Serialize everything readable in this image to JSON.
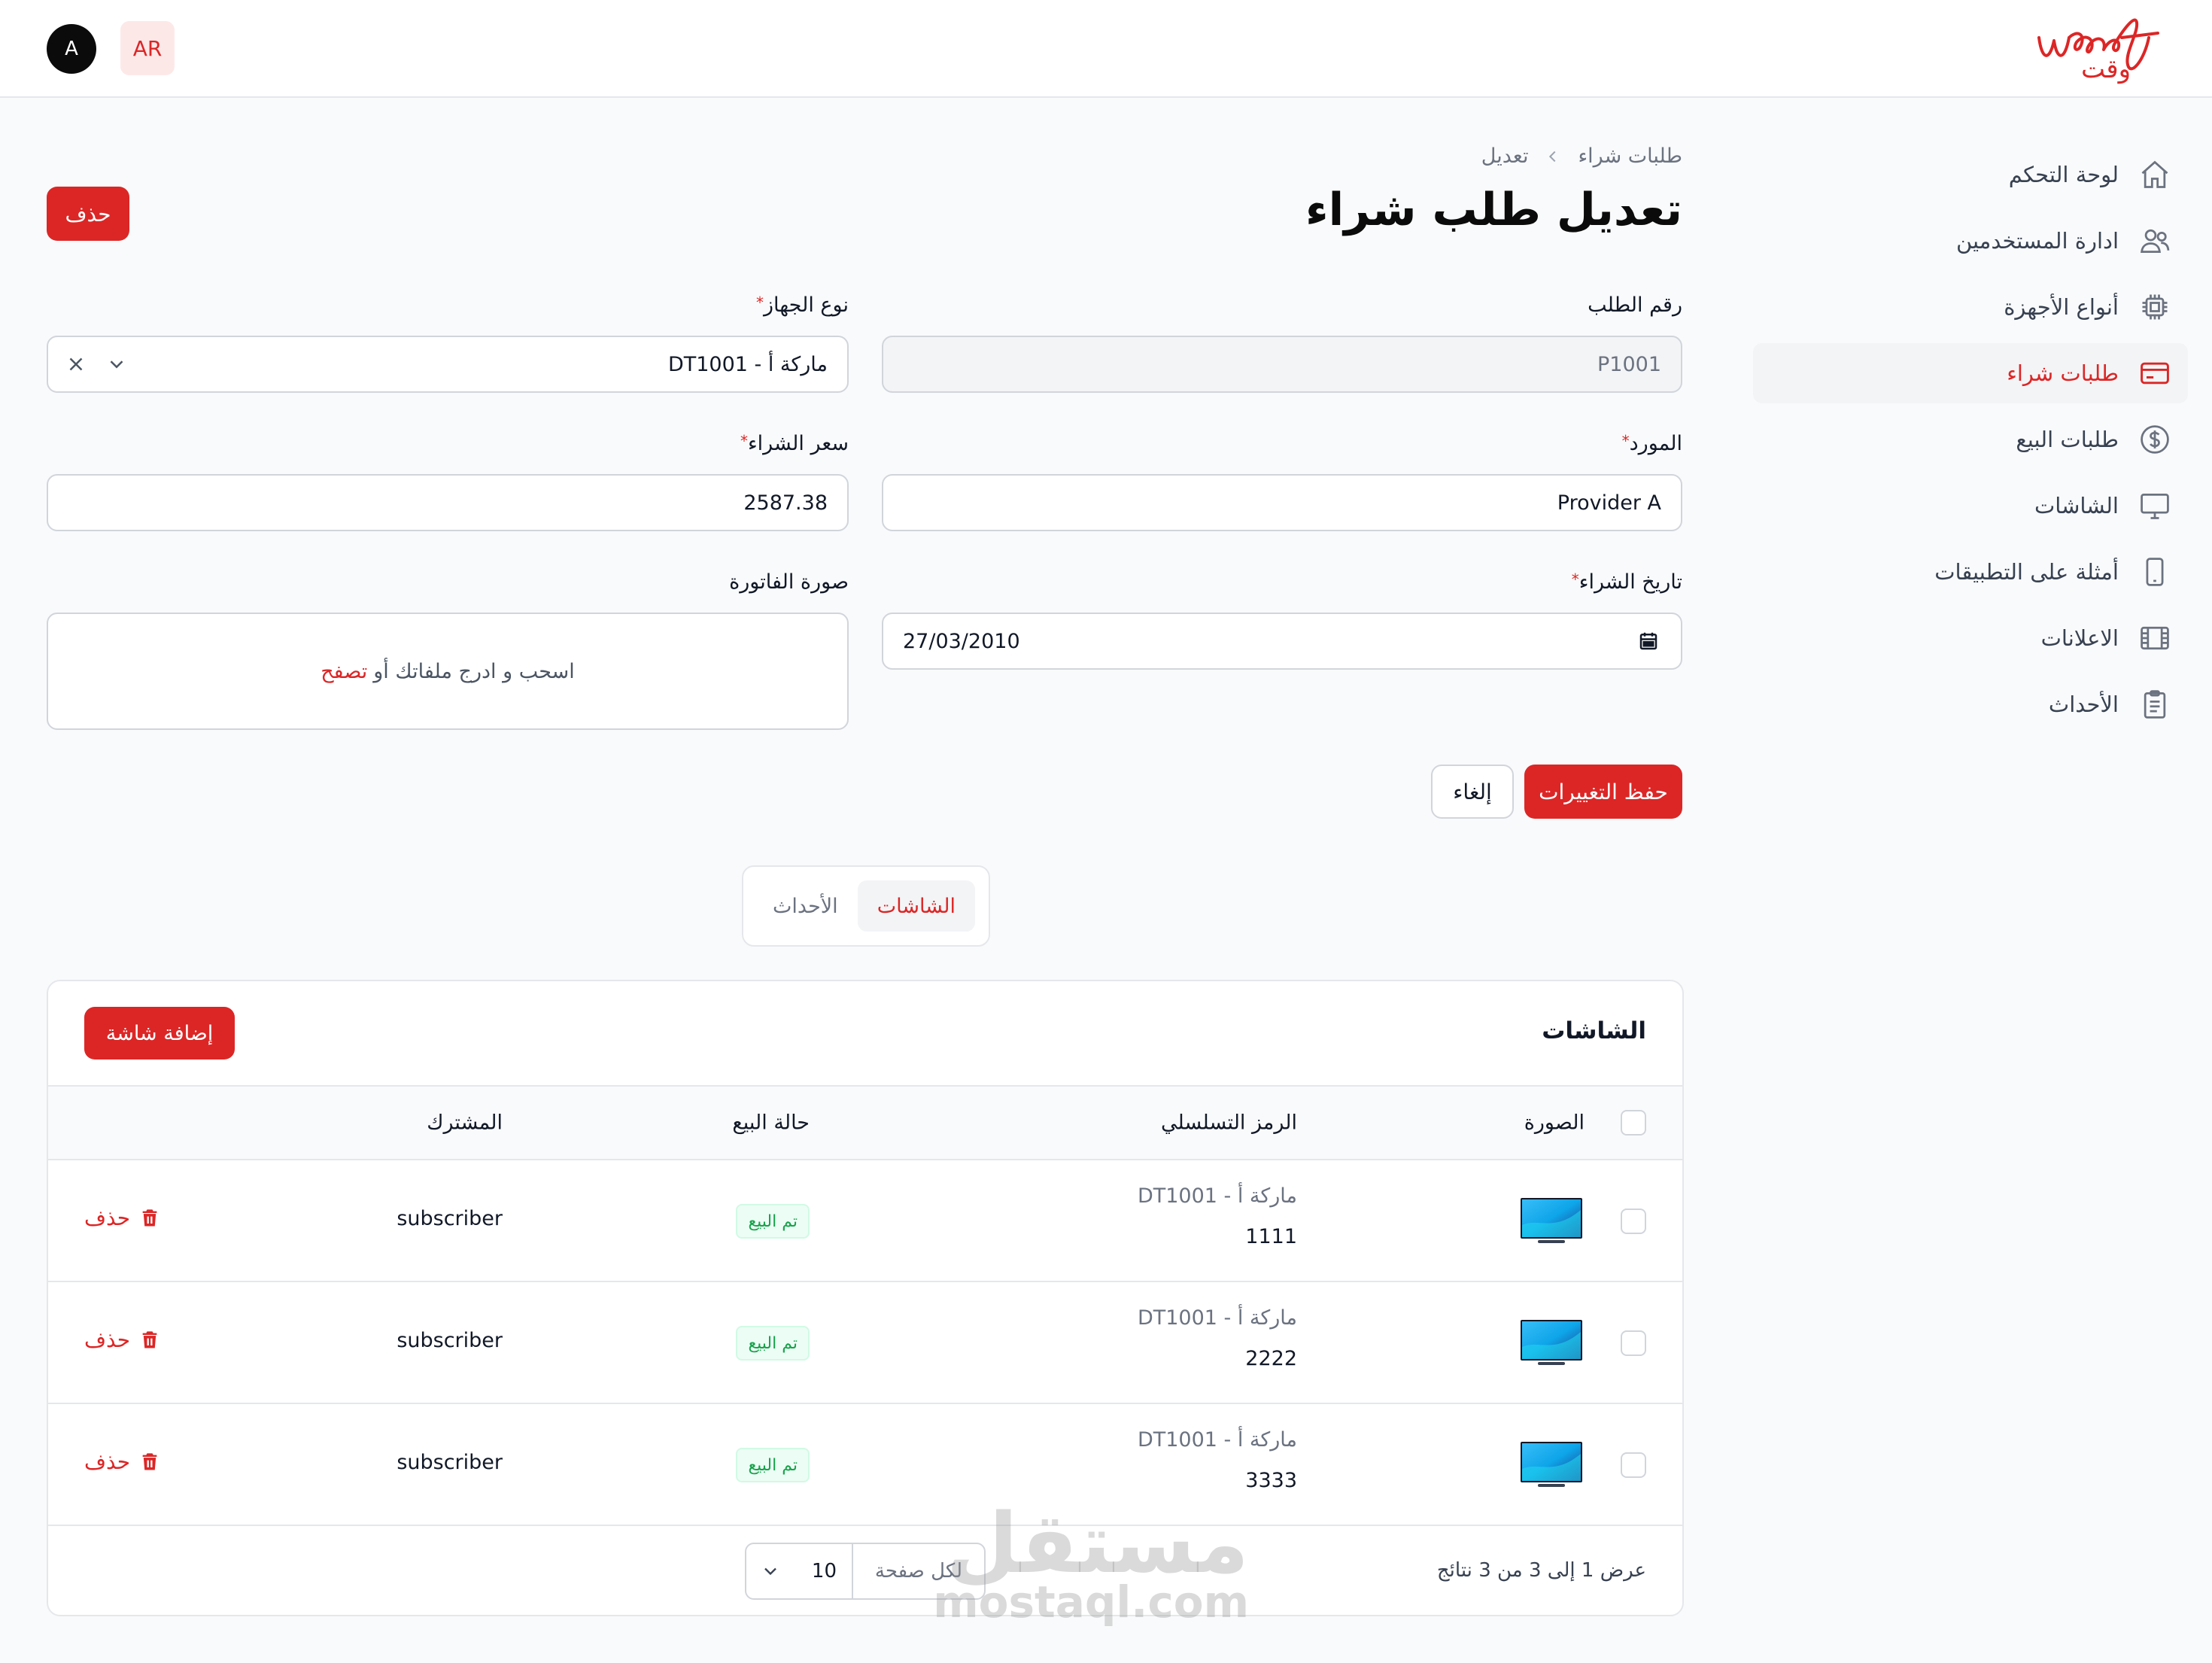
{
  "header": {
    "logo_script": "Waqt",
    "logo_arabic": "وقت",
    "lang_label": "AR",
    "avatar_initial": "A"
  },
  "sidebar": {
    "items": [
      {
        "label": "لوحة التحكم",
        "icon": "home-icon"
      },
      {
        "label": "ادارة المستخدمين",
        "icon": "users-icon"
      },
      {
        "label": "أنواع الأجهزة",
        "icon": "chip-icon"
      },
      {
        "label": "طلبات شراء",
        "icon": "credit-card-icon",
        "active": true
      },
      {
        "label": "طلبات البيع",
        "icon": "dollar-icon"
      },
      {
        "label": "الشاشات",
        "icon": "monitor-icon"
      },
      {
        "label": "أمثلة على التطبيقات",
        "icon": "phone-icon"
      },
      {
        "label": "الاعلانات",
        "icon": "film-icon"
      },
      {
        "label": "الأحداث",
        "icon": "clipboard-icon"
      }
    ]
  },
  "breadcrumb": {
    "parent": "طلبات شراء",
    "current": "تعديل"
  },
  "page": {
    "title": "تعديل طلب شراء",
    "delete_label": "حذف"
  },
  "form": {
    "order_number": {
      "label": "رقم الطلب",
      "value": "P1001"
    },
    "device_type": {
      "label": "نوع الجهاز",
      "required": "*",
      "value": "ماركة أ - DT1001"
    },
    "provider": {
      "label": "المورد",
      "required": "*",
      "value": "Provider A"
    },
    "purchase_price": {
      "label": "سعر الشراء",
      "required": "*",
      "value": "2587.38"
    },
    "purchase_date": {
      "label": "تاريخ الشراء",
      "required": "*",
      "value": "27/03/2010"
    },
    "invoice_image": {
      "label": "صورة الفاتورة",
      "drop_text": "اسحب و ادرج ملفاتك أو",
      "browse_text": "تصفح"
    },
    "save_label": "حفظ التغييرات",
    "cancel_label": "إلغاء"
  },
  "tabs": [
    {
      "label": "الشاشات",
      "active": true
    },
    {
      "label": "الأحداث",
      "active": false
    }
  ],
  "screens_table": {
    "title": "الشاشات",
    "add_label": "إضافة شاشة",
    "columns": {
      "image": "الصورة",
      "serial": "الرمز التسلسلي",
      "sale_status": "حالة البيع",
      "subscriber": "المشترك"
    },
    "rows": [
      {
        "device": "ماركة أ - DT1001",
        "serial": "1111",
        "status": "تم البيع",
        "subscriber": "subscriber",
        "delete": "حذف"
      },
      {
        "device": "ماركة أ - DT1001",
        "serial": "2222",
        "status": "تم البيع",
        "subscriber": "subscriber",
        "delete": "حذف"
      },
      {
        "device": "ماركة أ - DT1001",
        "serial": "3333",
        "status": "تم البيع",
        "subscriber": "subscriber",
        "delete": "حذف"
      }
    ],
    "footer": {
      "summary": "عرض 1 إلى 3 من 3 نتائج",
      "per_page_label": "لكل صفحة",
      "per_page_value": "10"
    }
  },
  "watermark": {
    "arabic": "مستقل",
    "latin": "mostaql.com"
  },
  "colors": {
    "accent": "#dc2626",
    "success": "#16a34a",
    "background": "#f9fafb"
  }
}
